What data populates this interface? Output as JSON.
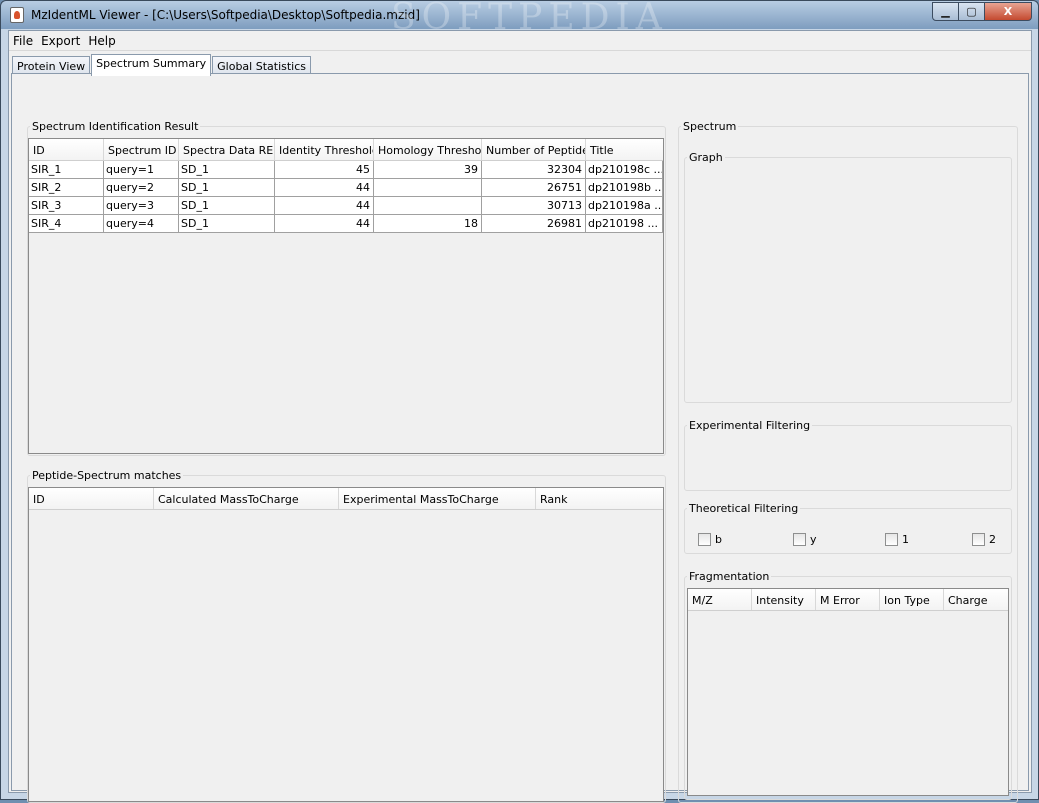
{
  "window": {
    "title": "MzIdentML Viewer  -  [C:\\Users\\Softpedia\\Desktop\\Softpedia.mzid]",
    "watermark": "SOFTPEDIA",
    "min_label": "▁",
    "max_label": "▢",
    "close_label": "X"
  },
  "menu": [
    "File",
    "Export",
    "Help"
  ],
  "tabs": [
    {
      "label": "Protein View",
      "active": false
    },
    {
      "label": "Spectrum Summary",
      "active": true
    },
    {
      "label": "Global Statistics",
      "active": false
    }
  ],
  "sir": {
    "title": "Spectrum Identification Result",
    "headers": [
      "ID",
      "Spectrum ID",
      "Spectra Data REF",
      "Identity Threshold",
      "Homology Threshold",
      "Number of Peptides",
      "Title"
    ],
    "rows": [
      [
        "SIR_1",
        "query=1",
        "SD_1",
        "45",
        "39",
        "32304",
        "dp210198c  ..."
      ],
      [
        "SIR_2",
        "query=2",
        "SD_1",
        "44",
        "",
        "26751",
        "dp210198b  ..."
      ],
      [
        "SIR_3",
        "query=3",
        "SD_1",
        "44",
        "",
        "30713",
        "dp210198a  ..."
      ],
      [
        "SIR_4",
        "query=4",
        "SD_1",
        "44",
        "18",
        "26981",
        "dp210198   ..."
      ]
    ]
  },
  "psm": {
    "title": "Peptide-Spectrum matches",
    "headers": [
      "ID",
      "Calculated MassToCharge",
      "Experimental MassToCharge",
      "Rank"
    ]
  },
  "spectrum": {
    "title": "Spectrum",
    "graph_title": "Graph",
    "experimental_title": "Experimental Filtering",
    "theoretical_title": "Theoretical Filtering",
    "checkboxes": [
      "b",
      "y",
      "1",
      "2"
    ],
    "fragmentation_title": "Fragmentation",
    "fragmentation_headers": [
      "M/Z",
      "Intensity",
      "M Error",
      "Ion Type",
      "Charge"
    ]
  }
}
